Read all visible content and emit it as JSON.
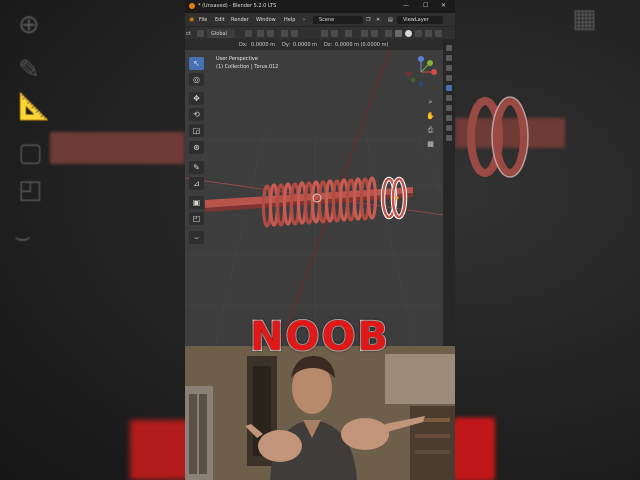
{
  "window": {
    "title": "* (Unsaved) - Blender 5.2.0 LTS"
  },
  "menubar": {
    "items": [
      "File",
      "Edit",
      "Render",
      "Window",
      "Help"
    ],
    "scene": "Scene",
    "view_layer": "ViewLayer"
  },
  "header": {
    "orientation": "Global"
  },
  "redo_panel": {
    "dx_label": "Dx:",
    "dx": "0.0000 m",
    "dy_label": "Dy:",
    "dy": "0.0000 m",
    "dz_label": "Dz:",
    "dz": "0.0000 m (0.0000 m)"
  },
  "viewport": {
    "view_name": "User Perspective",
    "collection_info": "(1) Collection | Torus.012"
  },
  "overlay": {
    "caption": "NOOB"
  },
  "colors": {
    "accent": "#4772b3",
    "object": "#c0574e",
    "selection": "#ffffff",
    "caption_red": "#e01818",
    "x_axis": "#c84a4a",
    "y_axis": "#7fb23a"
  },
  "icons": {
    "left_toolbar": [
      "select-box-icon",
      "cursor-icon",
      "move-icon",
      "rotate-icon",
      "scale-icon",
      "transform-icon",
      "annotate-icon",
      "measure-icon",
      "add-cube-icon",
      "extrude-icon",
      "curve-icon"
    ],
    "nav": [
      "zoom-icon",
      "hand-pan-icon",
      "camera-icon",
      "grid-icon"
    ]
  }
}
